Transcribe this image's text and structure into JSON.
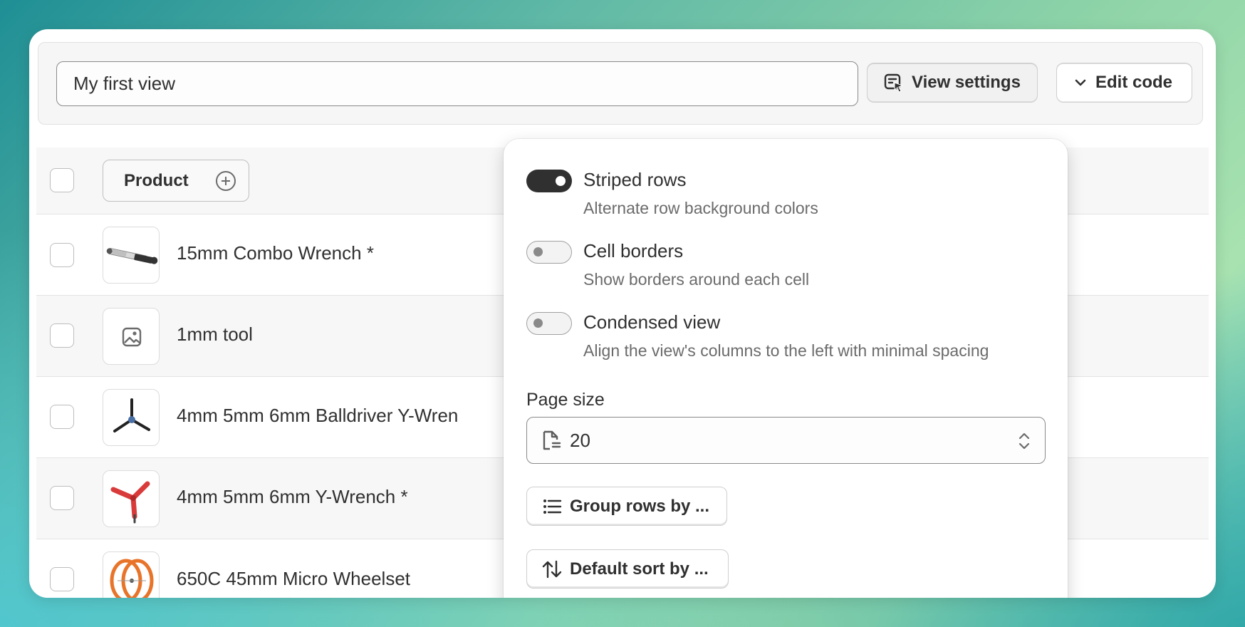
{
  "toolbar": {
    "view_name": "My first view",
    "view_settings_label": "View settings",
    "edit_code_label": "Edit code"
  },
  "table": {
    "column_header": "Product",
    "rows": [
      {
        "label": "15mm Combo Wrench *",
        "icon": "wrench-image"
      },
      {
        "label": "1mm tool",
        "icon": "image-placeholder-icon"
      },
      {
        "label": "4mm 5mm 6mm Balldriver Y-Wren",
        "icon": "y-wrench-black-image"
      },
      {
        "label": "4mm 5mm 6mm Y-Wrench *",
        "icon": "y-wrench-red-image"
      },
      {
        "label": "650C 45mm Micro Wheelset",
        "icon": "wheelset-image"
      }
    ]
  },
  "settings": {
    "options": [
      {
        "title": "Striped rows",
        "description": "Alternate row background colors",
        "enabled": true
      },
      {
        "title": "Cell borders",
        "description": "Show borders around each cell",
        "enabled": false
      },
      {
        "title": "Condensed view",
        "description": "Align the view's columns to the left with minimal spacing",
        "enabled": false
      }
    ],
    "page_size_label": "Page size",
    "page_size_value": "20",
    "group_rows_label": "Group rows by ...",
    "default_sort_label": "Default sort by ..."
  }
}
